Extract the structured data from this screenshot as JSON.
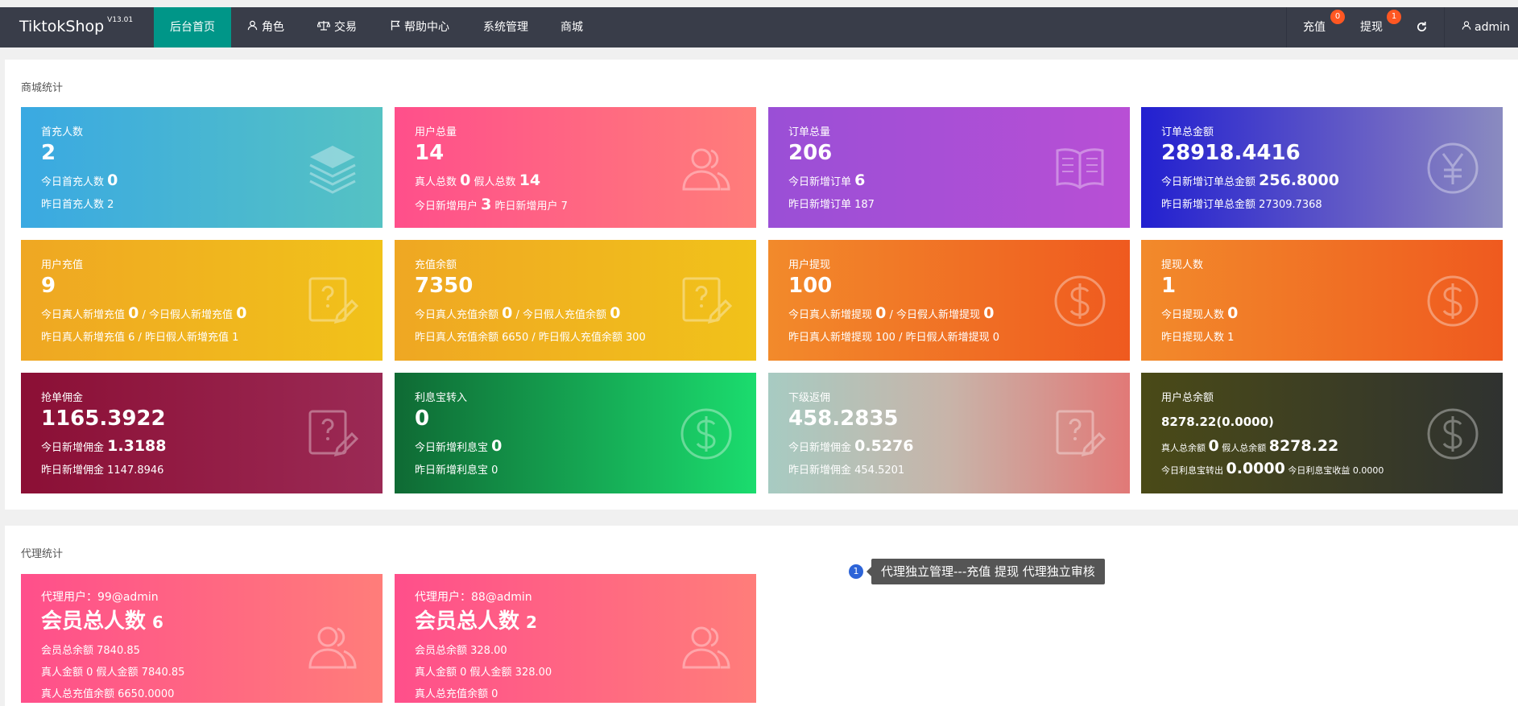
{
  "navbar": {
    "logo": "TiktokShop",
    "version": "V13.01",
    "items": [
      {
        "label": "后台首页"
      },
      {
        "label": "角色"
      },
      {
        "label": "交易"
      },
      {
        "label": "帮助中心"
      },
      {
        "label": "系统管理"
      },
      {
        "label": "商城"
      }
    ],
    "recharge": {
      "label": "充值",
      "badge": "0"
    },
    "withdraw": {
      "label": "提现",
      "badge": "1"
    },
    "user": "admin"
  },
  "shop_stats": {
    "title": "商城统计",
    "cards": [
      {
        "title": "首充人数",
        "value": "2",
        "l1_label": "今日首充人数",
        "l1_value": "0",
        "l2": "昨日首充人数 2"
      },
      {
        "title": "用户总量",
        "value": "14",
        "l1_a_label": "真人总数",
        "l1_a_value": "0",
        "l1_b_label": "假人总数",
        "l1_b_value": "14",
        "l2_a_label": "今日新增用户",
        "l2_a_value": "3",
        "l2_b": "昨日新增用户 7"
      },
      {
        "title": "订单总量",
        "value": "206",
        "l1_label": "今日新增订单",
        "l1_value": "6",
        "l2": "昨日新增订单 187"
      },
      {
        "title": "订单总金额",
        "value": "28918.4416",
        "l1_label": "今日新增订单总金额",
        "l1_value": "256.8000",
        "l2": "昨日新增订单总金额 27309.7368"
      },
      {
        "title": "用户充值",
        "value": "9",
        "l1_a_label": "今日真人新增充值",
        "l1_a_value": "0",
        "l1_b_label": "/ 今日假人新增充值",
        "l1_b_value": "0",
        "l2": "昨日真人新增充值 6 / 昨日假人新增充值 1"
      },
      {
        "title": "充值余额",
        "value": "7350",
        "l1_a_label": "今日真人充值余额",
        "l1_a_value": "0",
        "l1_b_label": "/ 今日假人充值余额",
        "l1_b_value": "0",
        "l2": "昨日真人充值余额 6650 / 昨日假人充值余额 300"
      },
      {
        "title": "用户提现",
        "value": "100",
        "l1_a_label": "今日真人新增提现",
        "l1_a_value": "0",
        "l1_b_label": "/ 今日假人新增提现",
        "l1_b_value": "0",
        "l2": "昨日真人新增提现 100 / 昨日假人新增提现 0"
      },
      {
        "title": "提现人数",
        "value": "1",
        "l1_label": "今日提现人数",
        "l1_value": "0",
        "l2": "昨日提现人数 1"
      },
      {
        "title": "抢单佣金",
        "value": "1165.3922",
        "l1_label": "今日新增佣金",
        "l1_value": "1.3188",
        "l2": "昨日新增佣金 1147.8946"
      },
      {
        "title": "利息宝转入",
        "value": "0",
        "l1_label": "今日新增利息宝",
        "l1_value": "0",
        "l2": "昨日新增利息宝 0"
      },
      {
        "title": "下级返佣",
        "value": "458.2835",
        "l1_label": "今日新增佣金",
        "l1_value": "0.5276",
        "l2": "昨日新增佣金 454.5201"
      },
      {
        "title": "用户总余额",
        "value": "8278.22(0.0000)",
        "l1_a_label": "真人总余额",
        "l1_a_value": "0",
        "l1_b_label": "假人总余额",
        "l1_b_value": "8278.22",
        "l2_a_label": "今日利息宝转出",
        "l2_a_value": "0.0000",
        "l2_b": "今日利息宝收益 0.0000"
      }
    ]
  },
  "agent_stats": {
    "title": "代理统计",
    "cards": [
      {
        "title": "代理用户：99@admin",
        "value_label": "会员总人数",
        "value": "6",
        "r1": "会员总余额 7840.85",
        "r2": "真人金额 0 假人金额 7840.85",
        "r3": "真人总充值余额 6650.0000"
      },
      {
        "title": "代理用户：88@admin",
        "value_label": "会员总人数",
        "value": "2",
        "r1": "会员总余额 328.00",
        "r2": "真人金额 0 假人金额 328.00",
        "r3": "真人总充值余额 0"
      }
    ]
  },
  "tooltip": {
    "number": "1",
    "text": "代理独立管理---充值 提现 代理独立审核"
  }
}
